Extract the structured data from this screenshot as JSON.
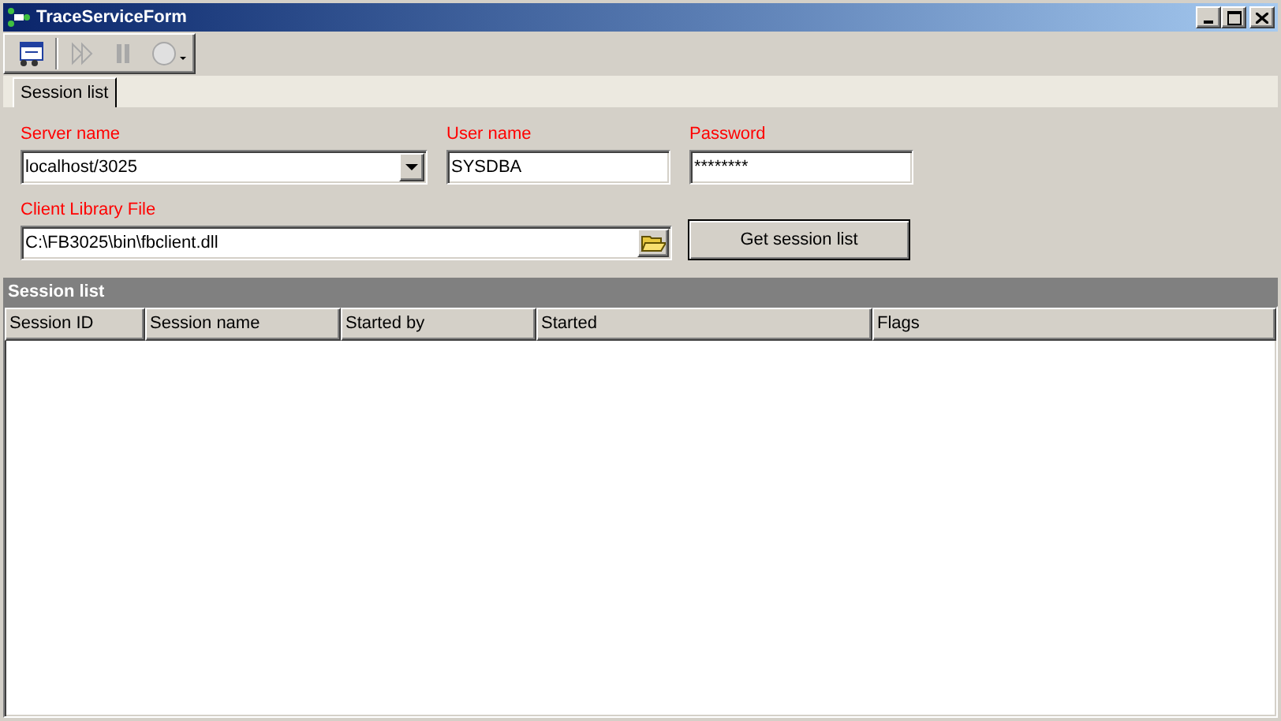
{
  "window": {
    "title": "TraceServiceForm"
  },
  "toolbar": [
    {
      "kind": "edit",
      "disabled": false
    },
    {
      "kind": "play",
      "disabled": true
    },
    {
      "kind": "pause",
      "disabled": true
    },
    {
      "kind": "stop",
      "disabled": true
    }
  ],
  "tabs": [
    {
      "label": "Session list",
      "selected": true
    }
  ],
  "form": {
    "server": {
      "label": "Server name",
      "value": "localhost/3025"
    },
    "user": {
      "label": "User name",
      "value": "SYSDBA"
    },
    "password": {
      "label": "Password",
      "value": "********"
    },
    "library": {
      "label": "Client Library File",
      "value": "C:\\FB3025\\bin\\fbclient.dll"
    },
    "button": "Get session list"
  },
  "session_list": {
    "title": "Session list",
    "columns": [
      "Session ID",
      "Session name",
      "Started by",
      "Started",
      "Flags"
    ]
  }
}
